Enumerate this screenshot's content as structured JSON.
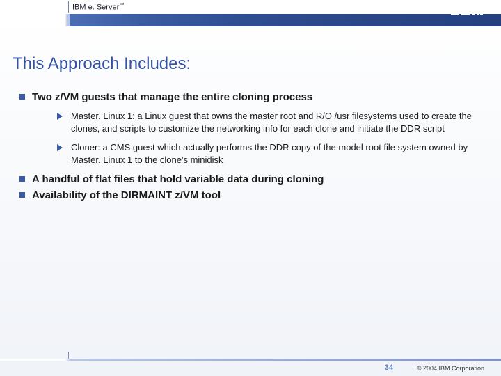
{
  "header": {
    "brand_prefix": "IBM e",
    "brand_suffix": ". Server",
    "brand_tm": "™"
  },
  "title": "This Approach Includes:",
  "bullets": [
    {
      "text": "Two z/VM guests that manage the entire cloning process",
      "sub": [
        "Master. Linux 1: a Linux guest that owns the master root and R/O /usr filesystems used to create the clones, and scripts to customize the networking info for each clone and initiate the DDR script",
        "Cloner: a CMS guest which actually performs the DDR copy of the model root file system owned by Master. Linux 1 to the clone's minidisk"
      ]
    },
    {
      "text": "A handful of flat files that hold variable data during cloning",
      "sub": []
    },
    {
      "text": "Availability of the DIRMAINT z/VM tool",
      "sub": []
    }
  ],
  "footer": {
    "page": "34",
    "copyright": "© 2004 IBM Corporation"
  }
}
